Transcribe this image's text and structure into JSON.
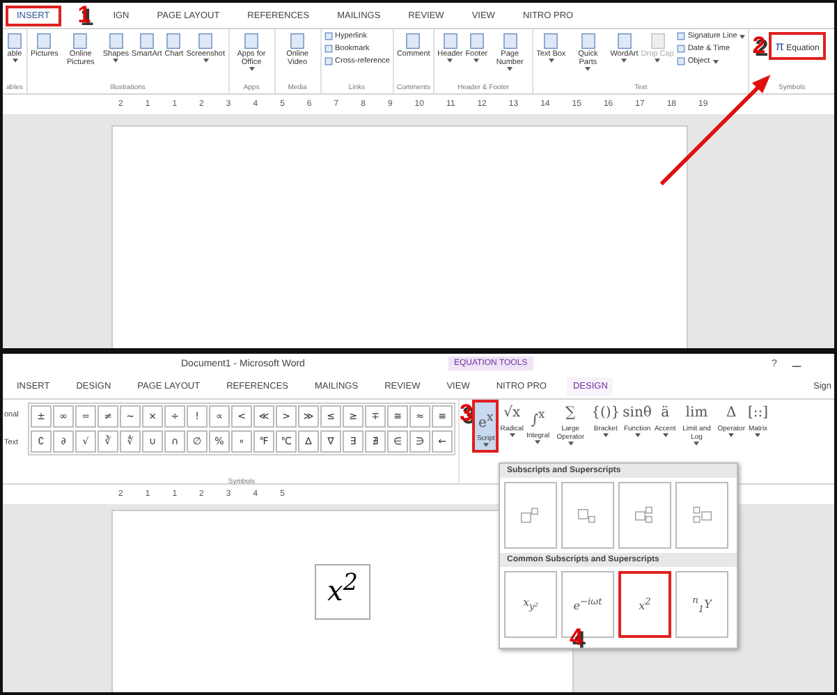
{
  "top_window": {
    "tabs": [
      {
        "label": "INSERT",
        "selected": true
      },
      {
        "label": "IGN",
        "selected": false
      },
      {
        "label": "PAGE LAYOUT",
        "selected": false
      },
      {
        "label": "REFERENCES",
        "selected": false
      },
      {
        "label": "MAILINGS",
        "selected": false
      },
      {
        "label": "REVIEW",
        "selected": false
      },
      {
        "label": "VIEW",
        "selected": false
      },
      {
        "label": "NITRO PRO",
        "selected": false
      }
    ],
    "callout_1": "1",
    "groups": [
      {
        "label": "ables",
        "items": [
          {
            "kind": "large",
            "label": "able",
            "dropdown": true
          }
        ]
      },
      {
        "label": "Illustrations",
        "items": [
          {
            "kind": "large",
            "label": "Pictures",
            "dropdown": false
          },
          {
            "kind": "large",
            "label": "Online Pictures",
            "dropdown": false
          },
          {
            "kind": "large",
            "label": "Shapes",
            "dropdown": true
          },
          {
            "kind": "large",
            "label": "SmartArt",
            "dropdown": false
          },
          {
            "kind": "large",
            "label": "Chart",
            "dropdown": false
          },
          {
            "kind": "large",
            "label": "Screenshot",
            "dropdown": true
          }
        ]
      },
      {
        "label": "Apps",
        "items": [
          {
            "kind": "large",
            "label": "Apps for Office",
            "dropdown": true
          }
        ]
      },
      {
        "label": "Media",
        "items": [
          {
            "kind": "large",
            "label": "Online Video",
            "dropdown": false
          }
        ]
      },
      {
        "label": "Links",
        "items": [
          {
            "kind": "small",
            "label": "Hyperlink",
            "dropdown": false
          },
          {
            "kind": "small",
            "label": "Bookmark",
            "dropdown": false
          },
          {
            "kind": "small",
            "label": "Cross-reference",
            "dropdown": false
          }
        ]
      },
      {
        "label": "Comments",
        "items": [
          {
            "kind": "large",
            "label": "Comment",
            "dropdown": false
          }
        ]
      },
      {
        "label": "Header & Footer",
        "items": [
          {
            "kind": "large",
            "label": "Header",
            "dropdown": true
          },
          {
            "kind": "large",
            "label": "Footer",
            "dropdown": true
          },
          {
            "kind": "large",
            "label": "Page Number",
            "dropdown": true
          }
        ]
      },
      {
        "label": "Text",
        "items": [
          {
            "kind": "large",
            "label": "Text Box",
            "dropdown": true
          },
          {
            "kind": "large",
            "label": "Quick Parts",
            "dropdown": true
          },
          {
            "kind": "large",
            "label": "WordArt",
            "dropdown": true
          },
          {
            "kind": "large",
            "label": "Drop Cap",
            "dropdown": true,
            "disabled": true
          },
          {
            "kind": "small",
            "label": "Signature Line",
            "dropdown": true
          },
          {
            "kind": "small",
            "label": "Date & Time",
            "dropdown": false
          },
          {
            "kind": "small",
            "label": "Object",
            "dropdown": true
          }
        ]
      }
    ],
    "callout_2": "2",
    "equation_group": {
      "symbol": "π",
      "label": "Equation",
      "group_label": "Symbols"
    },
    "ruler_numbers": [
      "2",
      "1",
      "1",
      "2",
      "3",
      "4",
      "5",
      "6",
      "7",
      "8",
      "9",
      "10",
      "11",
      "12",
      "13",
      "14",
      "15",
      "16",
      "17",
      "18",
      "19"
    ]
  },
  "bottom_window": {
    "title": "Document1 - Microsoft Word",
    "contextual_group": "EQUATION TOOLS",
    "help": "?",
    "sign_in": "Sign",
    "tabs": [
      {
        "label": "INSERT",
        "selected": false
      },
      {
        "label": "DESIGN",
        "selected": false
      },
      {
        "label": "PAGE LAYOUT",
        "selected": false
      },
      {
        "label": "REFERENCES",
        "selected": false
      },
      {
        "label": "MAILINGS",
        "selected": false
      },
      {
        "label": "REVIEW",
        "selected": false
      },
      {
        "label": "VIEW",
        "selected": false
      },
      {
        "label": "NITRO PRO",
        "selected": false
      },
      {
        "label": "DESIGN",
        "selected": true
      }
    ],
    "tools_labels": [
      "onal",
      "Text"
    ],
    "symbols": [
      [
        "±",
        "∞",
        "=",
        "≠",
        "~",
        "×",
        "÷",
        "!",
        "∝",
        "<",
        "≪",
        ">",
        "≫",
        "≤",
        "≥",
        "∓",
        "≅",
        "≈",
        "≡"
      ],
      [
        "∁",
        "∂",
        "√",
        "∛",
        "∜",
        "∪",
        "∩",
        "∅",
        "%",
        "∘",
        "℉",
        "℃",
        "∆",
        "∇",
        "∃",
        "∄",
        "∈",
        "∋",
        "←"
      ]
    ],
    "symbols_label": "Symbols",
    "callout_3": "3",
    "structures": [
      {
        "glyph": "e$^{x}$",
        "label": "Script",
        "selected": true
      },
      {
        "glyph": "√x",
        "label": "Radical",
        "selected": false
      },
      {
        "glyph": "∫$^{x}$",
        "label": "Integral",
        "selected": false
      },
      {
        "glyph": "∑",
        "label": "Large Operator",
        "selected": false
      },
      {
        "glyph": "{()}",
        "label": "Bracket",
        "selected": false
      },
      {
        "glyph": "sinθ",
        "label": "Function",
        "selected": false
      },
      {
        "glyph": "ä",
        "label": "Accent",
        "selected": false
      },
      {
        "glyph": "lim",
        "label": "Limit and Log",
        "selected": false
      },
      {
        "glyph": "Δ",
        "label": "Operator",
        "selected": false
      },
      {
        "glyph": "[::]",
        "label": "Matrix",
        "selected": false
      }
    ],
    "ruler_numbers": [
      "2",
      "1",
      "1",
      "2",
      "3",
      "4",
      "5"
    ],
    "equation": "x$^{2}$",
    "gallery": [
      {
        "title": "Subscripts and Superscripts",
        "items": [
          {
            "kind": "superscript",
            "selected": false
          },
          {
            "kind": "subscript",
            "selected": false
          },
          {
            "kind": "sub-superscript",
            "selected": false
          },
          {
            "kind": "left-sub-superscript",
            "selected": false
          }
        ]
      },
      {
        "title": "Common Subscripts and Superscripts",
        "items": [
          {
            "kind": "formula",
            "label": "x$_{y²}$",
            "selected": false
          },
          {
            "kind": "formula",
            "label": "e$^{−iωt}$",
            "selected": false
          },
          {
            "kind": "formula",
            "label": "x$^{2}$",
            "selected": true
          },
          {
            "kind": "formula",
            "label": "$^{n}$$_{1}$Y",
            "selected": false
          }
        ]
      }
    ],
    "callout_4": "4"
  }
}
